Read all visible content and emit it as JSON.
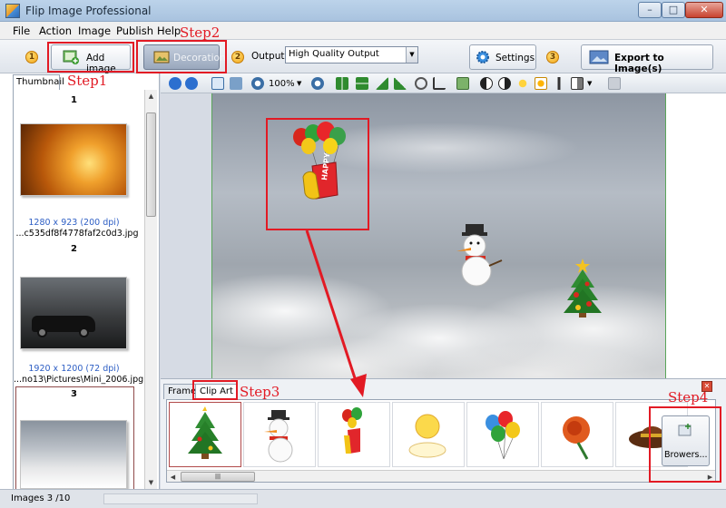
{
  "window": {
    "title": "Flip Image Professional",
    "minimize": "–",
    "maximize": "□",
    "close": "✕"
  },
  "menu": [
    "File",
    "Action",
    "Image",
    "Publish",
    "Help"
  ],
  "toolbar": {
    "step1_num": "1",
    "add_image": "Add image",
    "decoration": "Decoration",
    "step2_num": "2",
    "output_label": "Output:",
    "output_value": "High Quality Output",
    "settings": "Settings",
    "step3_num": "3",
    "export": "Export to Image(s)"
  },
  "thumbnails": {
    "tab": "Thumbnail",
    "items": [
      {
        "num": "1",
        "dims": "1280 x 923 (200 dpi)",
        "file": "...c535df8f4778faf2c0d3.jpg"
      },
      {
        "num": "2",
        "dims": "1920 x 1200 (72 dpi)",
        "file": "...no13\\Pictures\\Mini_2006.jpg"
      },
      {
        "num": "3"
      }
    ]
  },
  "image_toolbar": {
    "zoom": "100%"
  },
  "canvas": {
    "balloon_text": "HAPPY"
  },
  "clipart_panel": {
    "tabs": [
      "Frame",
      "Clip Art"
    ],
    "items": [
      "christmas-tree",
      "snowman",
      "happy-balloons",
      "sun-cloud",
      "balloons",
      "rose",
      "hat"
    ],
    "browse": "Browers..."
  },
  "status": {
    "text": "Images 3 /10"
  },
  "annotations": {
    "step1": "Step1",
    "step2": "Step2",
    "step3": "Step3",
    "step4": "Step4"
  },
  "colors": {
    "annotation_red": "#e21a24",
    "selection": "#5aa55a"
  }
}
